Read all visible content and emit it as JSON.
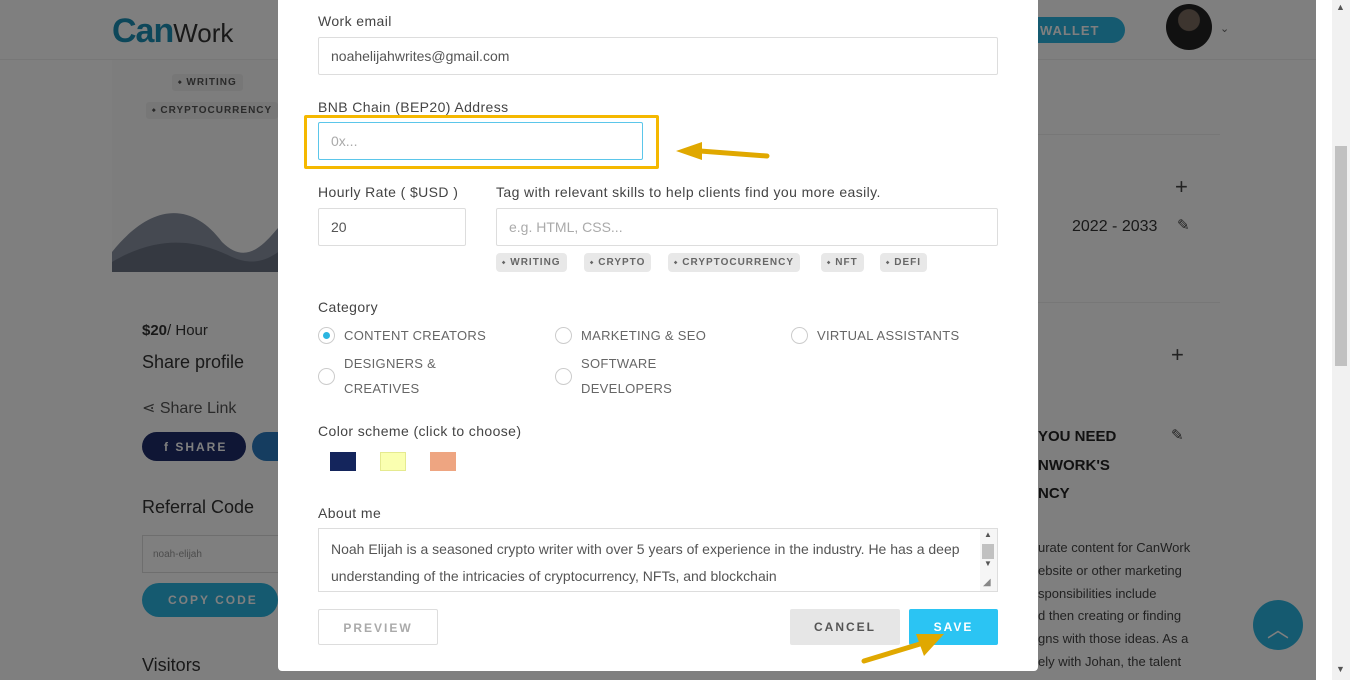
{
  "background": {
    "logo_can": "Can",
    "logo_work": "Work",
    "wallet_label": "WALLET",
    "left_tags": [
      "WRITING",
      "CRYPTOCURRENCY"
    ],
    "price_value": "$20",
    "price_unit": "/ Hour",
    "share_profile": "Share profile",
    "share_link": "Share Link",
    "share_button": "SHARE",
    "referral_title": "Referral Code",
    "referral_value": "noah-elijah",
    "copy_code": "COPY CODE",
    "visitors": "Visitors",
    "years": "2022 - 2033",
    "right_heading": [
      "YOU NEED",
      "NWORK'S",
      "NCY"
    ],
    "right_text": [
      "urate content for CanWork",
      "ebsite or other marketing",
      "sponsibilities include",
      "d then creating or finding",
      "gns with those ideas. As a",
      "ely with Johan, the talent"
    ]
  },
  "modal": {
    "work_email": {
      "label": "Work email",
      "value": "noahelijahwrites@gmail.com"
    },
    "bnb_address": {
      "label": "BNB Chain (BEP20) Address",
      "placeholder": "0x..."
    },
    "hourly_rate": {
      "label": "Hourly Rate ( $USD )",
      "value": "20"
    },
    "skills": {
      "label": "Tag with relevant skills to help clients find you more easily.",
      "placeholder": "e.g. HTML, CSS...",
      "tags": [
        "WRITING",
        "CRYPTO",
        "CRYPTOCURRENCY",
        "NFT",
        "DEFI"
      ]
    },
    "category": {
      "label": "Category",
      "options": [
        {
          "label": "CONTENT CREATORS",
          "selected": true
        },
        {
          "label": "MARKETING & SEO",
          "selected": false
        },
        {
          "label": "VIRTUAL ASSISTANTS",
          "selected": false
        },
        {
          "label": "DESIGNERS & CREATIVES",
          "line1": "DESIGNERS &",
          "line2": "CREATIVES",
          "selected": false
        },
        {
          "label": "SOFTWARE DEVELOPERS",
          "line1": "SOFTWARE",
          "line2": "DEVELOPERS",
          "selected": false
        }
      ]
    },
    "color_scheme": {
      "label": "Color scheme (click to choose)",
      "swatches": [
        "#14255c",
        "#faffb0",
        "#eea581"
      ]
    },
    "about": {
      "label": "About me",
      "value": "Noah Elijah is a seasoned crypto writer with over 5 years of experience in the industry. He has a deep understanding of the intricacies of cryptocurrency, NFTs, and blockchain"
    },
    "buttons": {
      "preview": "PREVIEW",
      "cancel": "CANCEL",
      "save": "SAVE"
    }
  },
  "colors": {
    "accent": "#2bc4f3",
    "highlight": "#f5b800",
    "overlay": "rgba(0,0,0,0.5)"
  }
}
